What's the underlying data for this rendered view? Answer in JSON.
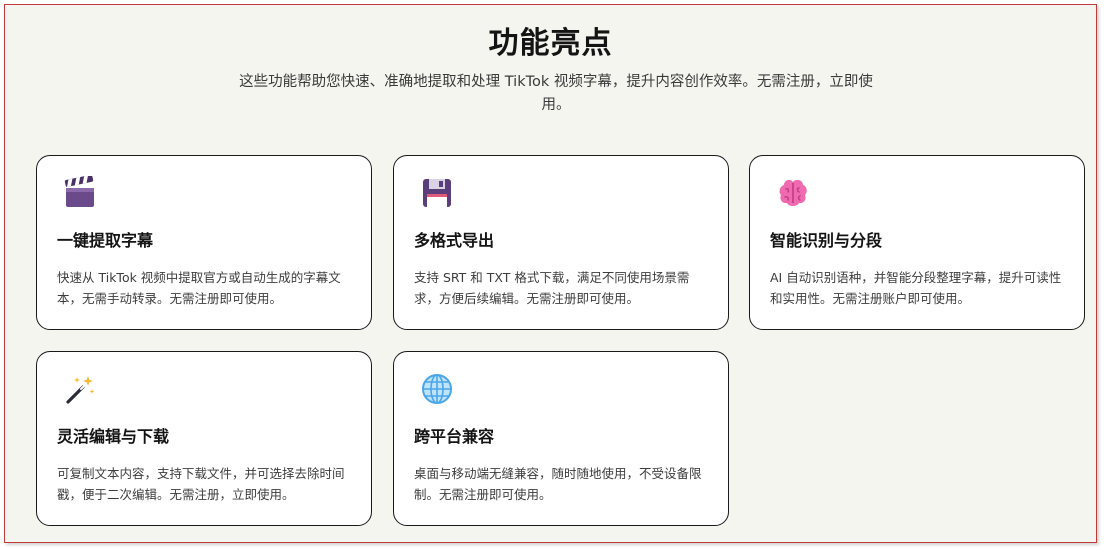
{
  "section": {
    "title": "功能亮点",
    "subtitle": "这些功能帮助您快速、准确地提取和处理 TikTok 视频字幕，提升内容创作效率。无需注册，立即使用。"
  },
  "features": [
    {
      "icon": "clapperboard-icon",
      "title": "一键提取字幕",
      "description": "快速从 TikTok 视频中提取官方或自动生成的字幕文本，无需手动转录。无需注册即可使用。"
    },
    {
      "icon": "floppy-disk-icon",
      "title": "多格式导出",
      "description": "支持 SRT 和 TXT 格式下载，满足不同使用场景需求，方便后续编辑。无需注册即可使用。"
    },
    {
      "icon": "brain-icon",
      "title": "智能识别与分段",
      "description": "AI 自动识别语种，并智能分段整理字幕，提升可读性和实用性。无需注册账户即可使用。"
    },
    {
      "icon": "magic-wand-icon",
      "title": "灵活编辑与下载",
      "description": "可复制文本内容，支持下载文件，并可选择去除时间戳，便于二次编辑。无需注册，立即使用。"
    },
    {
      "icon": "globe-icon",
      "title": "跨平台兼容",
      "description": "桌面与移动端无缝兼容，随时随地使用，不受设备限制。无需注册即可使用。"
    }
  ]
}
